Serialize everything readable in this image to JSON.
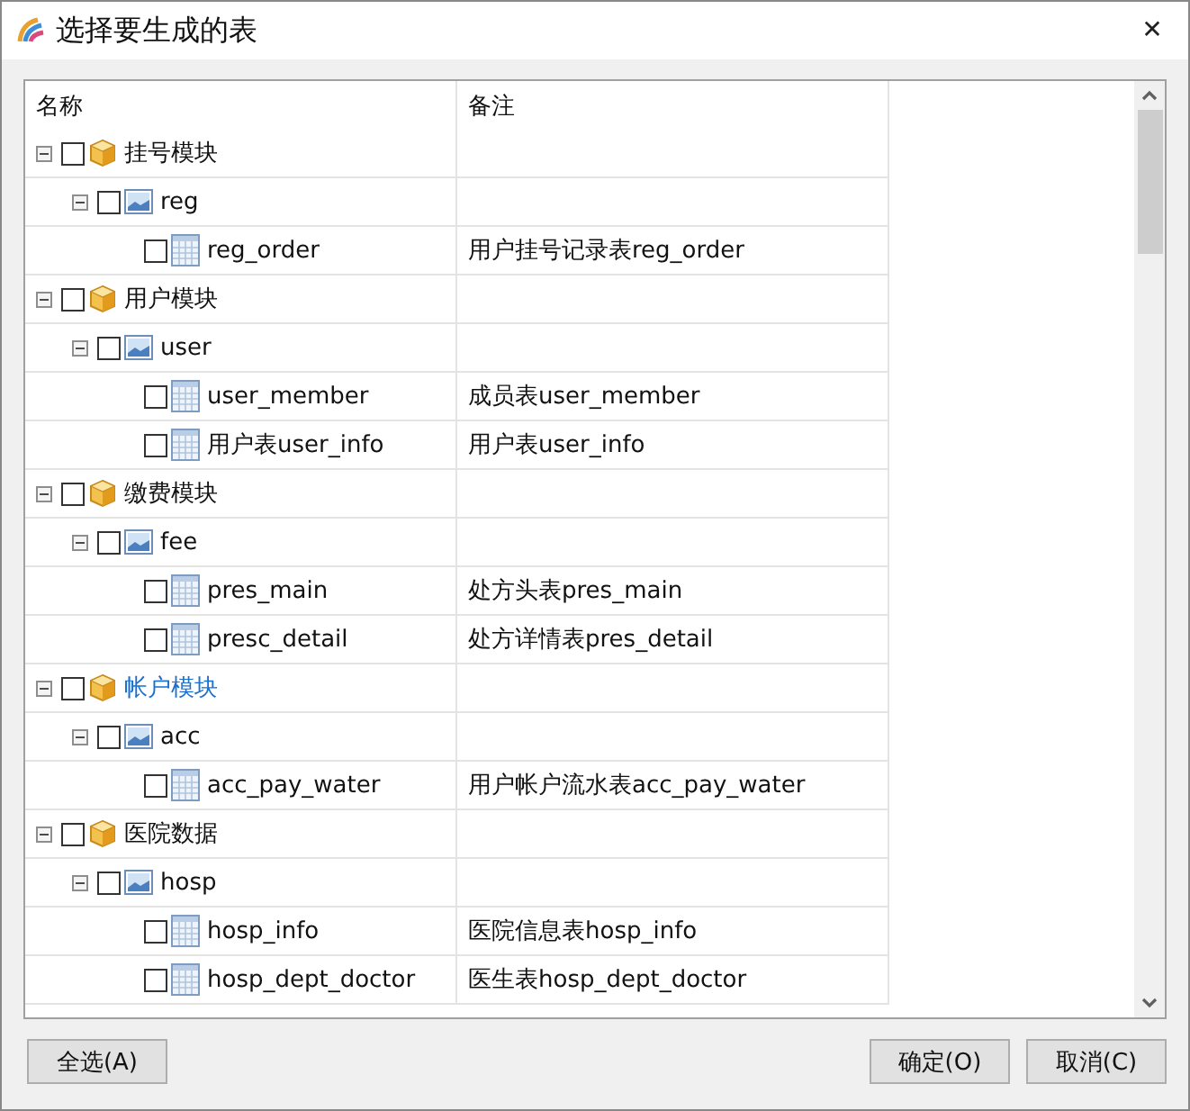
{
  "window": {
    "title": "选择要生成的表",
    "close": "✕"
  },
  "table": {
    "columns": [
      "名称",
      "备注"
    ],
    "rows": [
      {
        "kind": "module",
        "name": "挂号模块",
        "hot": false,
        "checked": false,
        "expanded": true,
        "children": [
          {
            "kind": "schema",
            "name": "reg",
            "checked": false,
            "expanded": true,
            "children": [
              {
                "kind": "table",
                "name": "reg_order",
                "note": "用户挂号记录表reg_order",
                "checked": false
              }
            ]
          }
        ]
      },
      {
        "kind": "module",
        "name": "用户模块",
        "hot": false,
        "checked": false,
        "expanded": true,
        "children": [
          {
            "kind": "schema",
            "name": "user",
            "checked": false,
            "expanded": true,
            "children": [
              {
                "kind": "table",
                "name": "user_member",
                "note": "成员表user_member",
                "checked": false
              },
              {
                "kind": "table",
                "name": "用户表user_info",
                "note": "用户表user_info",
                "checked": false
              }
            ]
          }
        ]
      },
      {
        "kind": "module",
        "name": "缴费模块",
        "hot": false,
        "checked": false,
        "expanded": true,
        "children": [
          {
            "kind": "schema",
            "name": "fee",
            "checked": false,
            "expanded": true,
            "children": [
              {
                "kind": "table",
                "name": "pres_main",
                "note": "处方头表pres_main",
                "checked": false
              },
              {
                "kind": "table",
                "name": "presc_detail",
                "note": "处方详情表pres_detail",
                "checked": false
              }
            ]
          }
        ]
      },
      {
        "kind": "module",
        "name": "帐户模块",
        "hot": true,
        "checked": false,
        "expanded": true,
        "children": [
          {
            "kind": "schema",
            "name": "acc",
            "checked": false,
            "expanded": true,
            "children": [
              {
                "kind": "table",
                "name": "acc_pay_water",
                "note": "用户帐户流水表acc_pay_water",
                "checked": false
              }
            ]
          }
        ]
      },
      {
        "kind": "module",
        "name": "医院数据",
        "hot": false,
        "checked": false,
        "expanded": true,
        "children": [
          {
            "kind": "schema",
            "name": "hosp",
            "checked": false,
            "expanded": true,
            "children": [
              {
                "kind": "table",
                "name": "hosp_info",
                "note": "医院信息表hosp_info",
                "checked": false
              },
              {
                "kind": "table",
                "name": "hosp_dept_doctor",
                "note": "医生表hosp_dept_doctor",
                "checked": false
              }
            ]
          }
        ]
      }
    ]
  },
  "buttons": [
    {
      "kind": "select_all",
      "label": "全选(A)"
    },
    {
      "kind": "ok",
      "label": "确定(O)"
    },
    {
      "kind": "cancel",
      "label": "取消(C)"
    }
  ]
}
